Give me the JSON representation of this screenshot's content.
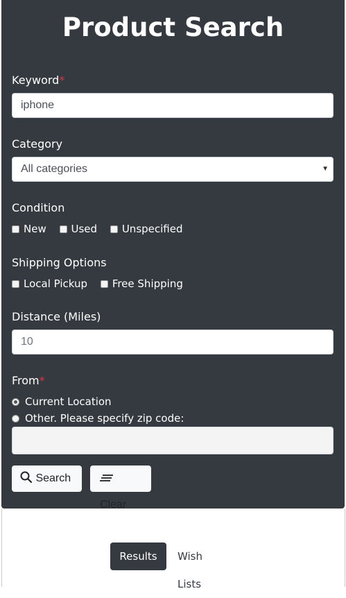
{
  "title": "Product Search",
  "keyword": {
    "label": "Keyword",
    "required_mark": "*",
    "value": "iphone"
  },
  "category": {
    "label": "Category",
    "selected": "All categories"
  },
  "condition": {
    "label": "Condition",
    "options": [
      "New",
      "Used",
      "Unspecified"
    ]
  },
  "shipping": {
    "label": "Shipping Options",
    "options": [
      "Local Pickup",
      "Free Shipping"
    ]
  },
  "distance": {
    "label": "Distance (Miles)",
    "placeholder": "10"
  },
  "from": {
    "label": "From",
    "required_mark": "*",
    "current": "Current Location",
    "other": "Other. Please specify zip code:",
    "selected": "current"
  },
  "buttons": {
    "search": "Search",
    "clear": "Clear"
  },
  "tabs": {
    "results": "Results",
    "wish_lists": "Wish Lists",
    "active": "results"
  },
  "colors": {
    "panel": "#343a40",
    "required": "#dc3545",
    "button": "#f8f9fa"
  },
  "icons": {
    "search": "magnifier-icon",
    "clear": "clear-lines-icon",
    "select": "caret-down-icon"
  }
}
